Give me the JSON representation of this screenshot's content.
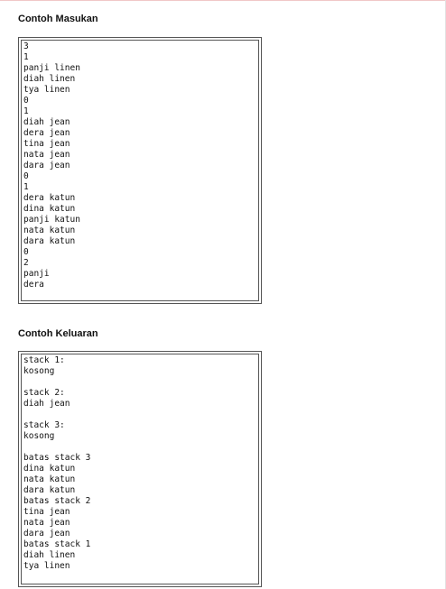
{
  "sample_input": {
    "title": "Contoh Masukan",
    "text": "3\n1\npanji linen\ndiah linen\ntya linen\n0\n1\ndiah jean\ndera jean\ntina jean\nnata jean\ndara jean\n0\n1\ndera katun\ndina katun\npanji katun\nnata katun\ndara katun\n0\n2\npanji\ndera"
  },
  "sample_output": {
    "title": "Contoh Keluaran",
    "text": "stack 1:\nkosong\n\nstack 2:\ndiah jean\n\nstack 3:\nkosong\n\nbatas stack 3\ndina katun\nnata katun\ndara katun\nbatas stack 2\ntina jean\nnata jean\ndara jean\nbatas stack 1\ndiah linen\ntya linen"
  }
}
